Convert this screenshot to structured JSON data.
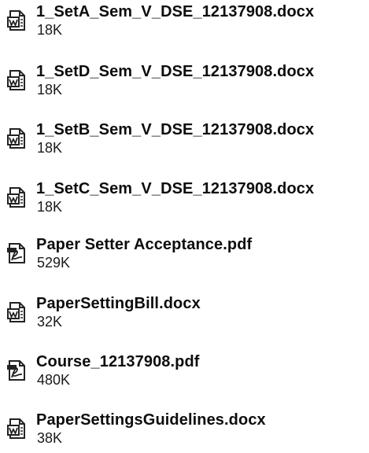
{
  "files": [
    {
      "name": "1_SetA_Sem_V_DSE_12137908.docx",
      "size": "18K",
      "icon": "word-doc-icon"
    },
    {
      "name": "1_SetD_Sem_V_DSE_12137908.docx",
      "size": "18K",
      "icon": "word-doc-icon"
    },
    {
      "name": "1_SetB_Sem_V_DSE_12137908.docx",
      "size": "18K",
      "icon": "word-doc-icon"
    },
    {
      "name": "1_SetC_Sem_V_DSE_12137908.docx",
      "size": "18K",
      "icon": "word-doc-icon"
    },
    {
      "name": "Paper Setter Acceptance.pdf",
      "size": "529K",
      "icon": "pdf-icon"
    },
    {
      "name": "PaperSettingBill.docx",
      "size": "32K",
      "icon": "word-doc-icon"
    },
    {
      "name": "Course_12137908.pdf",
      "size": "480K",
      "icon": "pdf-icon"
    },
    {
      "name": "PaperSettingsGuidelines.docx",
      "size": "38K",
      "icon": "word-doc-icon"
    }
  ]
}
